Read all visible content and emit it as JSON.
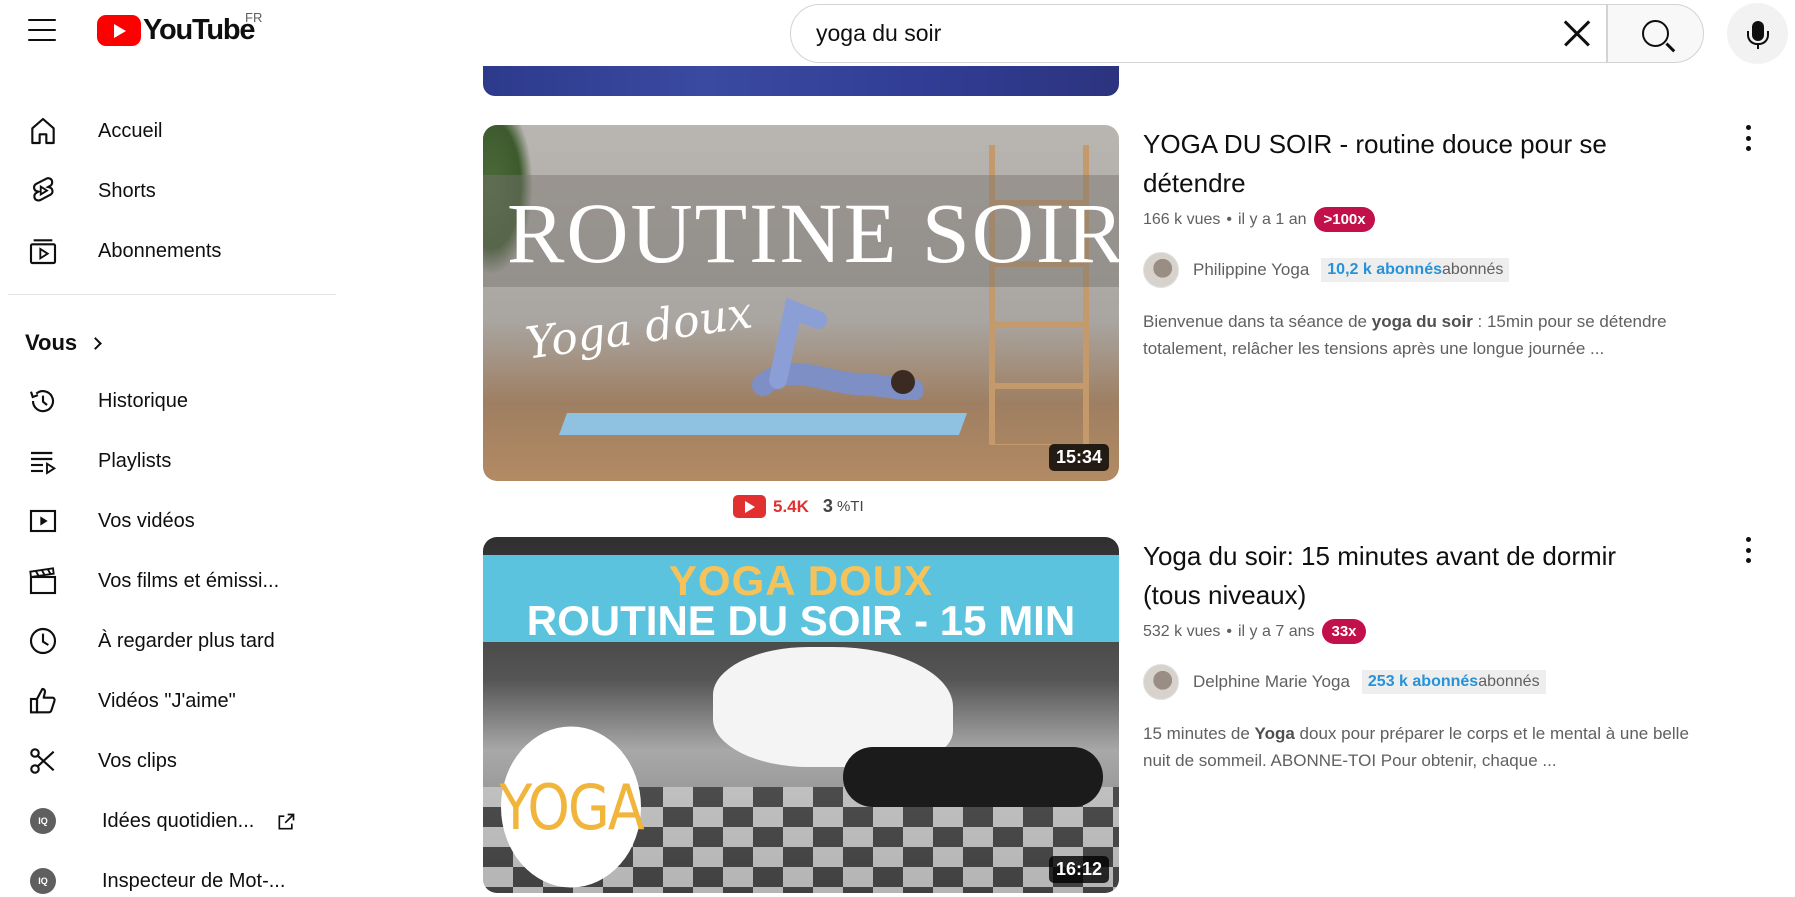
{
  "header": {
    "logo_text": "YouTube",
    "country": "FR",
    "search_value": "yoga du soir"
  },
  "sidebar": {
    "items": [
      {
        "label": "Accueil",
        "icon": "home-icon"
      },
      {
        "label": "Shorts",
        "icon": "shorts-icon"
      },
      {
        "label": "Abonnements",
        "icon": "subscriptions-icon"
      }
    ],
    "you_label": "Vous",
    "you_items": [
      {
        "label": "Historique",
        "icon": "history-icon"
      },
      {
        "label": "Playlists",
        "icon": "playlists-icon"
      },
      {
        "label": "Vos vidéos",
        "icon": "your-videos-icon"
      },
      {
        "label": "Vos films et émissi...",
        "icon": "movies-icon"
      },
      {
        "label": "À regarder plus tard",
        "icon": "watch-later-icon"
      },
      {
        "label": "Vidéos \"J'aime\"",
        "icon": "like-icon"
      },
      {
        "label": "Vos clips",
        "icon": "clips-icon"
      },
      {
        "label": "Idées quotidien...",
        "icon": "extension-iq-icon"
      },
      {
        "label": "Inspecteur de Mot-...",
        "icon": "extension-iq-icon"
      }
    ],
    "extension_badge": "IQ"
  },
  "results": [
    {
      "thumb_title": "ROUTINE SOIR",
      "thumb_script": "Yoga doux",
      "duration": "15:34",
      "title": "YOGA DU SOIR - routine douce pour se détendre",
      "views": "166 k vues",
      "age": "il y a 1 an",
      "badge": ">100x",
      "channel": "Philippine Yoga",
      "subs_count": "10,2 k abonnés",
      "subs_word": "abonnés",
      "desc_prefix": "Bienvenue dans ta séance de ",
      "desc_bold": "yoga du soir",
      "desc_suffix": " : 15min pour se détendre totalement, relâcher les tensions après une longue journée ..."
    },
    {
      "thumb_line1": "YOGA DOUX",
      "thumb_line2": "ROUTINE DU SOIR - 15 MIN",
      "thumb_circle": "YOGA",
      "duration": "16:12",
      "title": "Yoga du soir: 15 minutes avant de dormir (tous niveaux)",
      "views": "532 k vues",
      "age": "il y a 7 ans",
      "badge": "33x",
      "channel": "Delphine Marie Yoga",
      "subs_count": "253 k abonnés",
      "subs_word": "abonnés",
      "desc_prefix": "15 minutes de ",
      "desc_bold": "Yoga",
      "desc_suffix": " doux pour préparer le corps et le mental à une belle nuit de sommeil. ABONNE-TOI Pour obtenir, chaque ..."
    }
  ],
  "stats": {
    "views": "5.4K",
    "number": "3",
    "unit": "%TI"
  },
  "dot_separator": "•",
  "colors": {
    "brand_red": "#ff0000",
    "badge_crimson": "#c2114a",
    "subs_blue": "#2693d8"
  }
}
